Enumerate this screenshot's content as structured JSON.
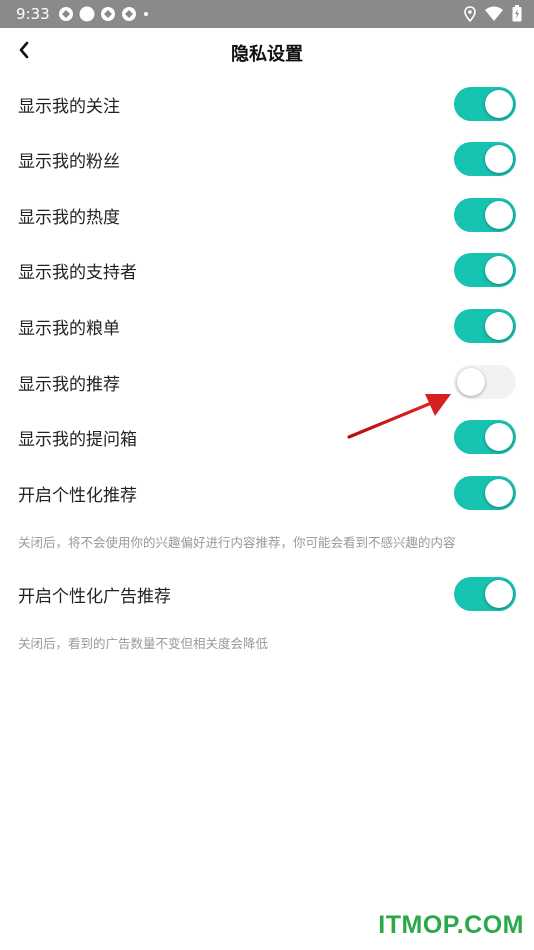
{
  "status_bar": {
    "time": "9:33",
    "icons": [
      "sync-icon",
      "circle-icon",
      "sync-icon",
      "sync-icon",
      "dot-icon"
    ],
    "right_icons": [
      "location-icon",
      "wifi-icon",
      "battery-icon"
    ]
  },
  "header": {
    "title": "隐私设置"
  },
  "settings": [
    {
      "label": "显示我的关注",
      "enabled": true
    },
    {
      "label": "显示我的粉丝",
      "enabled": true
    },
    {
      "label": "显示我的热度",
      "enabled": true
    },
    {
      "label": "显示我的支持者",
      "enabled": true
    },
    {
      "label": "显示我的粮单",
      "enabled": true
    },
    {
      "label": "显示我的推荐",
      "enabled": false
    },
    {
      "label": "显示我的提问箱",
      "enabled": true
    },
    {
      "label": "开启个性化推荐",
      "enabled": true
    },
    {
      "label": "开启个性化广告推荐",
      "enabled": true
    }
  ],
  "hints": {
    "personalized": "关闭后，将不会使用你的兴趣偏好进行内容推荐，你可能会看到不感兴趣的内容",
    "ads": "关闭后，看到的广告数量不变但相关度会降低"
  },
  "colors": {
    "accent": "#16c2b0",
    "toggle_off": "#f2f2f2",
    "annotation_arrow": "#d62020",
    "watermark": "#2aa84a"
  },
  "watermark": "ITMOP.COM"
}
